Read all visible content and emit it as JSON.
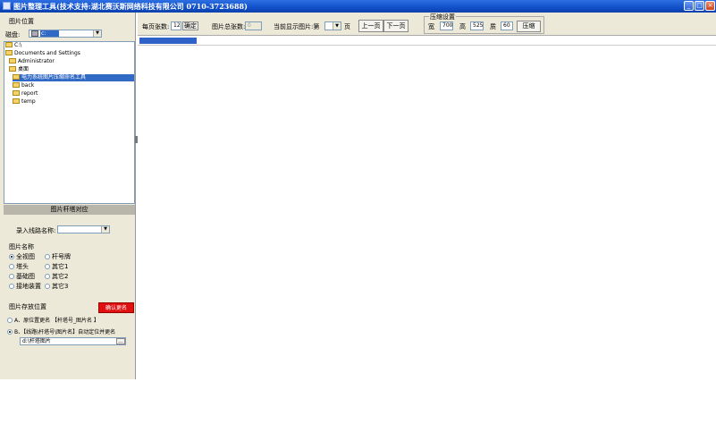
{
  "window": {
    "title": "图片整理工具(技术支持:湖北赛沃斯网络科技有限公司 0710-3723688)",
    "app_icon": "app-icon",
    "controls": [
      "_",
      "□",
      "×"
    ]
  },
  "left": {
    "location_group": "图片位置",
    "drive_label": "磁盘:",
    "drive_value": "c:",
    "tree": [
      {
        "label": "C:\\",
        "level": 0
      },
      {
        "label": "Documents and Settings",
        "level": 0
      },
      {
        "label": "Administrator",
        "level": 1
      },
      {
        "label": "桌面",
        "level": 1
      },
      {
        "label": "电力系统图片压缩命名工具",
        "level": 2,
        "selected": true
      },
      {
        "label": "back",
        "level": 2
      },
      {
        "label": "report",
        "level": 2
      },
      {
        "label": "temp",
        "level": 2
      }
    ],
    "tower_section": "图片杆塔对应",
    "line_name_label": "录入线路名称:",
    "line_name_value": "",
    "picture_name_group": "图片名称",
    "name_options": [
      {
        "label": "全视图",
        "checked": true
      },
      {
        "label": "杆号牌",
        "checked": false
      },
      {
        "label": "塔头",
        "checked": false
      },
      {
        "label": "其它1",
        "checked": false
      },
      {
        "label": "基础图",
        "checked": false
      },
      {
        "label": "其它2",
        "checked": false
      },
      {
        "label": "接地装置",
        "checked": false
      },
      {
        "label": "其它3",
        "checked": false
      }
    ],
    "storage_group": "图片存放位置",
    "confirm_rename": "确认更名",
    "storage_options": [
      {
        "label": "A、原位置更名 【杆塔号_图片名 】",
        "checked": false
      },
      {
        "label": "B、【线路\\杆塔号\\图片名】自动定位并更名",
        "checked": true
      }
    ],
    "path_value": "d:\\杆塔图片",
    "browse_label": "..."
  },
  "toolbar": {
    "per_page_label": "每页张数:",
    "per_page_value": "12",
    "confirm_label": "确定",
    "total_label": "图片总张数:",
    "total_value": "0",
    "current_label": "当前显示图片:第",
    "current_value": "",
    "page_suffix": "页",
    "prev_label": "上一页",
    "next_label": "下一页",
    "compress_group": "压缩设置",
    "width_label": "宽",
    "width_value": "700",
    "height_label": "高",
    "height_value": "525",
    "quality_label": "质",
    "quality_value": "60",
    "compress_button": "压缩"
  },
  "colors": {
    "titlebar": "#1150c9",
    "selection": "#316ac5",
    "confirm": "#e01010",
    "progress": "#2f62c9"
  }
}
